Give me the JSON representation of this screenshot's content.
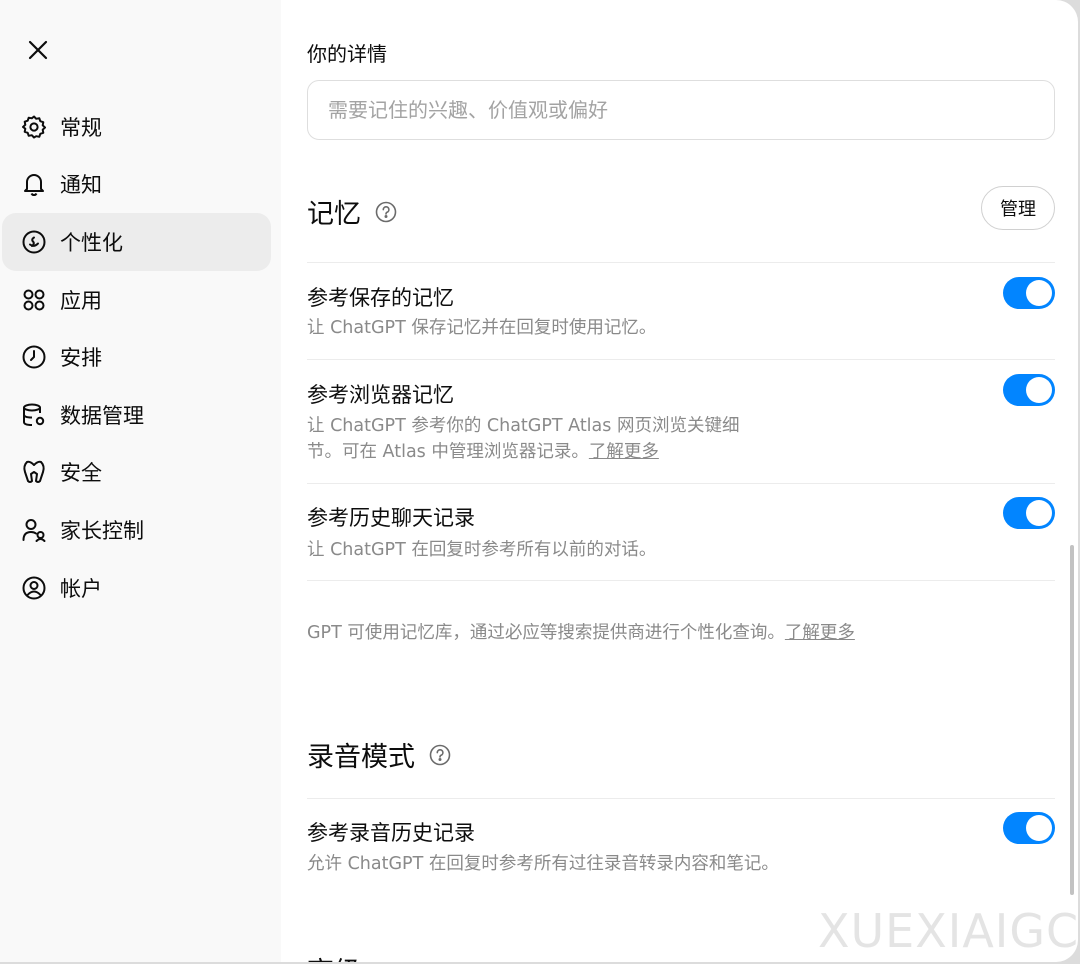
{
  "top_strip_text": "",
  "sidebar": {
    "items": [
      {
        "label": "常规",
        "icon": "gear-icon"
      },
      {
        "label": "通知",
        "icon": "bell-icon"
      },
      {
        "label": "个性化",
        "icon": "personalization-icon",
        "active": true
      },
      {
        "label": "应用",
        "icon": "apps-grid-icon"
      },
      {
        "label": "安排",
        "icon": "clock-icon"
      },
      {
        "label": "数据管理",
        "icon": "database-icon"
      },
      {
        "label": "安全",
        "icon": "security-icon"
      },
      {
        "label": "家长控制",
        "icon": "parental-control-icon"
      },
      {
        "label": "帐户",
        "icon": "account-icon"
      }
    ]
  },
  "details": {
    "label": "你的详情",
    "placeholder": "需要记住的兴趣、价值观或偏好",
    "value": ""
  },
  "memory": {
    "title": "记忆",
    "manage_label": "管理",
    "settings": [
      {
        "title": "参考保存的记忆",
        "desc": "让 ChatGPT 保存记忆并在回复时使用记忆。",
        "enabled": true
      },
      {
        "title": "参考浏览器记忆",
        "desc": "让 ChatGPT 参考你的 ChatGPT Atlas 网页浏览关键细节。可在 Atlas 中管理浏览器记录。",
        "link": "了解更多",
        "enabled": true
      },
      {
        "title": "参考历史聊天记录",
        "desc": "让 ChatGPT 在回复时参考所有以前的对话。",
        "enabled": true
      }
    ],
    "footnote": "GPT 可使用记忆库，通过必应等搜索提供商进行个性化查询。",
    "footnote_link": "了解更多"
  },
  "voice": {
    "title": "录音模式",
    "settings": [
      {
        "title": "参考录音历史记录",
        "desc": "允许 ChatGPT 在回复时参考所有过往录音转录内容和笔记。",
        "enabled": true
      }
    ]
  },
  "partial_section_title": "高级",
  "watermark": "XUEXIAIGC",
  "colors": {
    "toggle_on": "#0285ff",
    "active_nav_bg": "#ececec",
    "sidebar_bg": "#f9f9f9"
  }
}
